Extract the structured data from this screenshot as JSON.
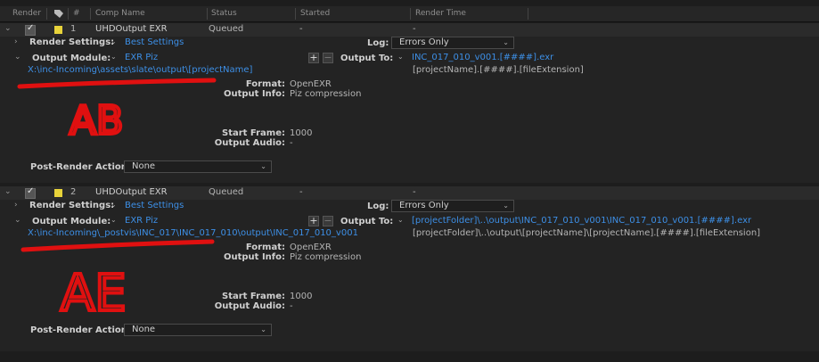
{
  "header": {
    "render": "Render",
    "num": "#",
    "comp_name": "Comp Name",
    "status": "Status",
    "started": "Started",
    "render_time": "Render Time"
  },
  "items": [
    {
      "index": "1",
      "comp": "UHDOutput EXR",
      "status": "Queued",
      "started": "-",
      "render_time": "-",
      "render_settings_label": "Render Settings:",
      "render_settings": "Best Settings",
      "log_label": "Log:",
      "log": "Errors Only",
      "output_module_label": "Output Module:",
      "output_module": "EXR Piz",
      "output_to_label": "Output To:",
      "output_to": "INC_017_010_v001.[####].exr",
      "output_template": "[projectName].[####].[fileExtension]",
      "path": "X:\\inc-Incoming\\assets\\slate\\output\\[projectName]",
      "format_label": "Format:",
      "format": "OpenEXR",
      "output_info_label": "Output Info:",
      "output_info": "Piz compression",
      "start_frame_label": "Start Frame:",
      "start_frame": "1000",
      "output_audio_label": "Output Audio:",
      "output_audio": "-",
      "post_render_label": "Post-Render Action:",
      "post_render": "None",
      "annotation": "AB"
    },
    {
      "index": "2",
      "comp": "UHDOutput EXR",
      "status": "Queued",
      "started": "-",
      "render_time": "-",
      "render_settings_label": "Render Settings:",
      "render_settings": "Best Settings",
      "log_label": "Log:",
      "log": "Errors Only",
      "output_module_label": "Output Module:",
      "output_module": "EXR Piz",
      "output_to_label": "Output To:",
      "output_to": "[projectFolder]\\..\\output\\INC_017_010_v001\\INC_017_010_v001.[####].exr",
      "output_template": "[projectFolder]\\..\\output\\[projectName]\\[projectName].[####].[fileExtension]",
      "path": "X:\\inc-Incoming\\_postvis\\INC_017\\INC_017_010\\output\\INC_017_010_v001",
      "format_label": "Format:",
      "format": "OpenEXR",
      "output_info_label": "Output Info:",
      "output_info": "Piz compression",
      "start_frame_label": "Start Frame:",
      "start_frame": "1000",
      "output_audio_label": "Output Audio:",
      "output_audio": "-",
      "post_render_label": "Post-Render Action:",
      "post_render": "None",
      "annotation": "AE"
    }
  ],
  "colors": {
    "link": "#3d8fe6",
    "label_swatch": "#e8d33a",
    "annotation": "#e01010"
  }
}
